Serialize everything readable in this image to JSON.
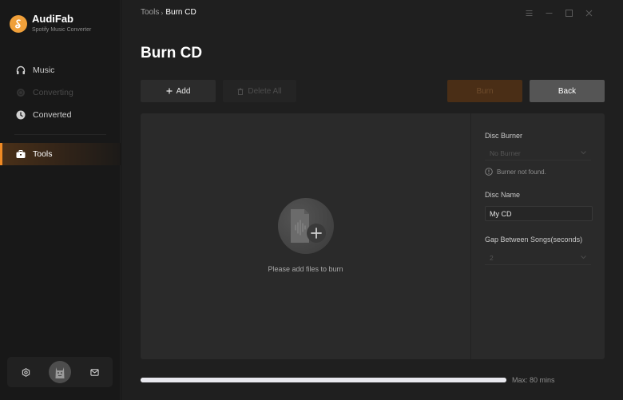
{
  "app": {
    "name": "AudiFab",
    "subtitle": "Spotify Music Converter",
    "accent_color": "#f08a24",
    "logo_color": "#f0a03a"
  },
  "sidebar": {
    "items": [
      {
        "label": "Music",
        "icon": "headphones-icon",
        "state": "normal"
      },
      {
        "label": "Converting",
        "icon": "converting-icon",
        "state": "disabled"
      },
      {
        "label": "Converted",
        "icon": "clock-icon",
        "state": "normal"
      },
      {
        "label": "Tools",
        "icon": "toolbox-icon",
        "state": "active"
      }
    ],
    "footer": {
      "settings_icon": "gear-icon",
      "avatar": "avatar",
      "mail_icon": "mail-icon"
    }
  },
  "titlebar": {
    "breadcrumb": {
      "parent": "Tools",
      "separator": "›",
      "current": "Burn CD"
    },
    "controls": [
      "menu-icon",
      "minimize-icon",
      "maximize-icon",
      "close-icon"
    ]
  },
  "page": {
    "title": "Burn CD"
  },
  "toolbar": {
    "add_label": "Add",
    "delete_all_label": "Delete All",
    "burn_label": "Burn",
    "back_label": "Back"
  },
  "drop_area": {
    "hint": "Please add files to burn"
  },
  "settings": {
    "disc_burner_label": "Disc Burner",
    "disc_burner_value": "No Burner",
    "burner_warning": "Burner not found.",
    "disc_name_label": "Disc Name",
    "disc_name_value": "My CD",
    "gap_label": "Gap Between Songs(seconds)",
    "gap_value": "2"
  },
  "capacity": {
    "max_label": "Max: 80 mins",
    "used_fraction": 1.0
  }
}
